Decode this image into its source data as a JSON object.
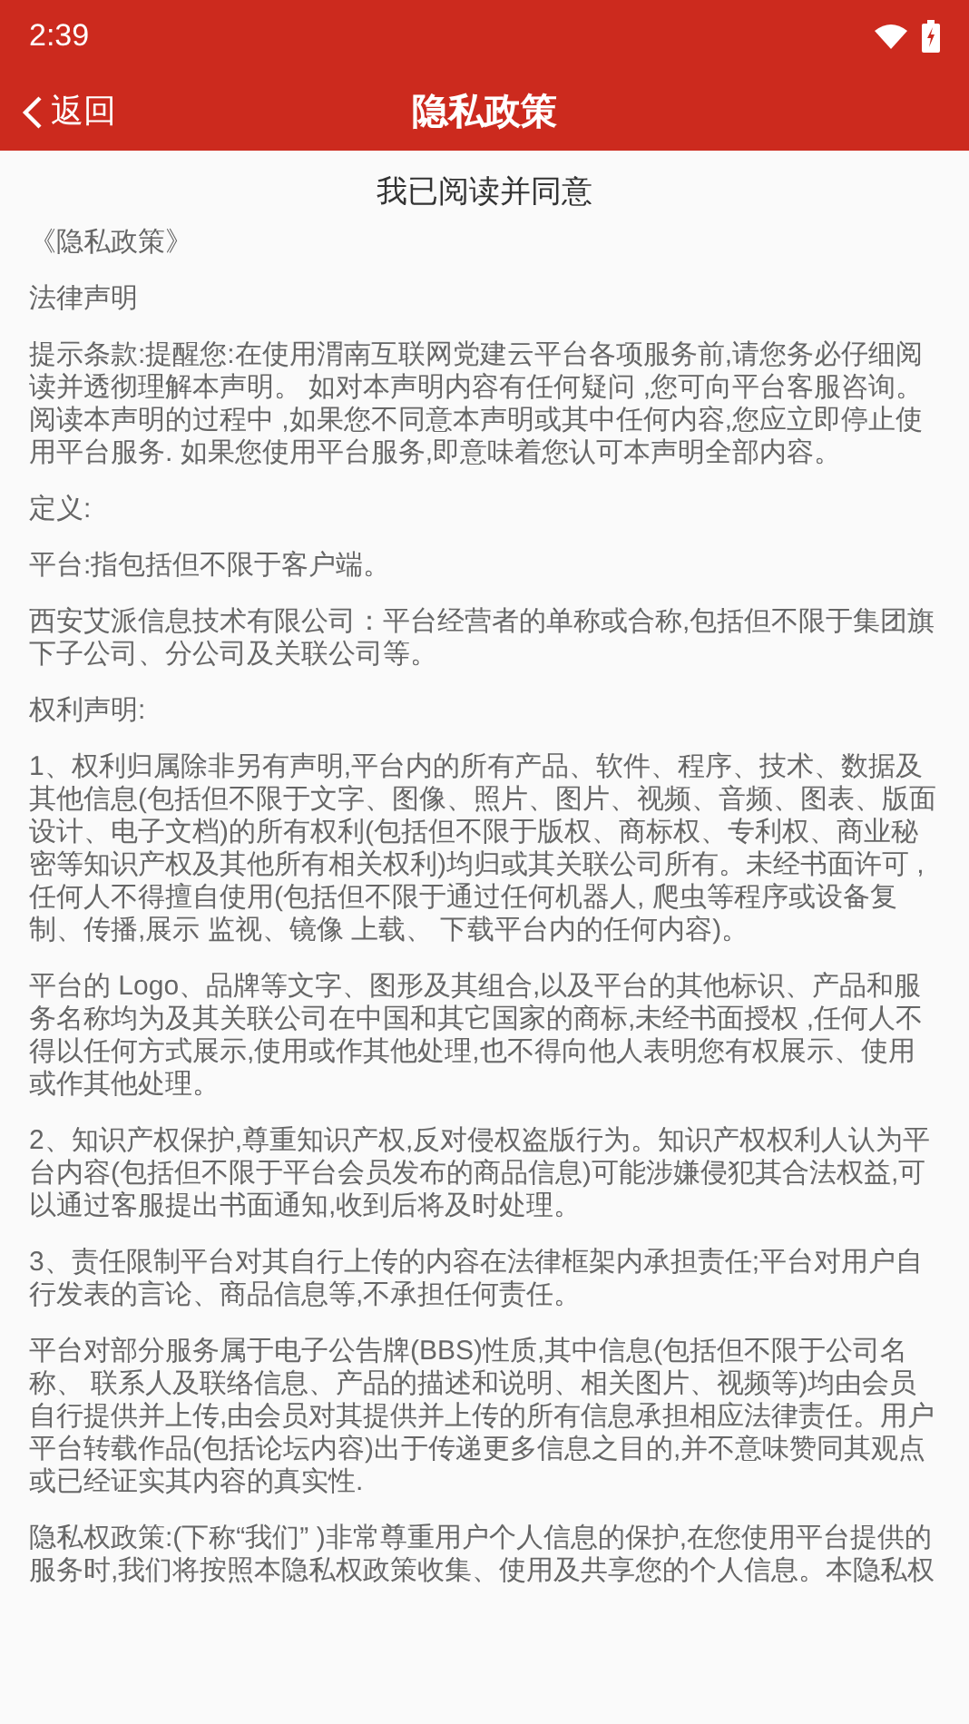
{
  "status_bar": {
    "time": "2:39"
  },
  "header": {
    "back": "返回",
    "title": "隐私政策"
  },
  "agree_title": "我已阅读并同意",
  "paragraphs": [
    "《隐私政策》",
    "法律声明",
    "提示条款:提醒您:在使用渭南互联网党建云平台各项服务前,请您务必仔细阅读并透彻理解本声明。 如对本声明内容有任何疑问 ,您可向平台客服咨询。阅读本声明的过程中 ,如果您不同意本声明或其中任何内容,您应立即停止使用平台服务. 如果您使用平台服务,即意味着您认可本声明全部内容。",
    "定义:",
    "平台:指包括但不限于客户端。",
    "西安艾派信息技术有限公司：平台经营者的单称或合称,包括但不限于集团旗下子公司、分公司及关联公司等。",
    "权利声明:",
    "1、权利归属除非另有声明,平台内的所有产品、软件、程序、技术、数据及其他信息(包括但不限于文字、图像、照片、图片、视频、音频、图表、版面设计、电子文档)的所有权利(包括但不限于版权、商标权、专利权、商业秘密等知识产权及其他所有相关权利)均归或其关联公司所有。未经书面许可 ,任何人不得擅自使用(包括但不限于通过任何机器人, 爬虫等程序或设备复制、传播,展示 监视、镜像 上载、 下载平台内的任何内容)。",
    "平台的 Logo、品牌等文字、图形及其组合,以及平台的其他标识、产品和服务名称均为及其关联公司在中国和其它国家的商标,未经书面授权 ,任何人不得以任何方式展示,使用或作其他处理,也不得向他人表明您有权展示、使用或作其他处理。",
    "2、知识产权保护,尊重知识产权,反对侵权盗版行为。知识产权权利人认为平台内容(包括但不限于平台会员发布的商品信息)可能涉嫌侵犯其合法权益,可以通过客服提出书面通知,收到后将及时处理。",
    "3、责任限制平台对其自行上传的内容在法律框架内承担责任;平台对用户自行发表的言论、商品信息等,不承担任何责任。",
    "平台对部分服务属于电子公告牌(BBS)性质,其中信息(包括但不限于公司名称、 联系人及联络信息、产品的描述和说明、相关图片、视频等)均由会员自行提供并上传,由会员对其提供并上传的所有信息承担相应法律责任。用户平台转载作品(包括论坛内容)出于传递更多信息之目的,并不意味赞同其观点或已经证实其内容的真实性.",
    "隐私权政策:(下称“我们” )非常尊重用户个人信息的保护,在您使用平台提供的服务时,我们将按照本隐私权政策收集、使用及共享您的个人信息。本隐私权"
  ]
}
